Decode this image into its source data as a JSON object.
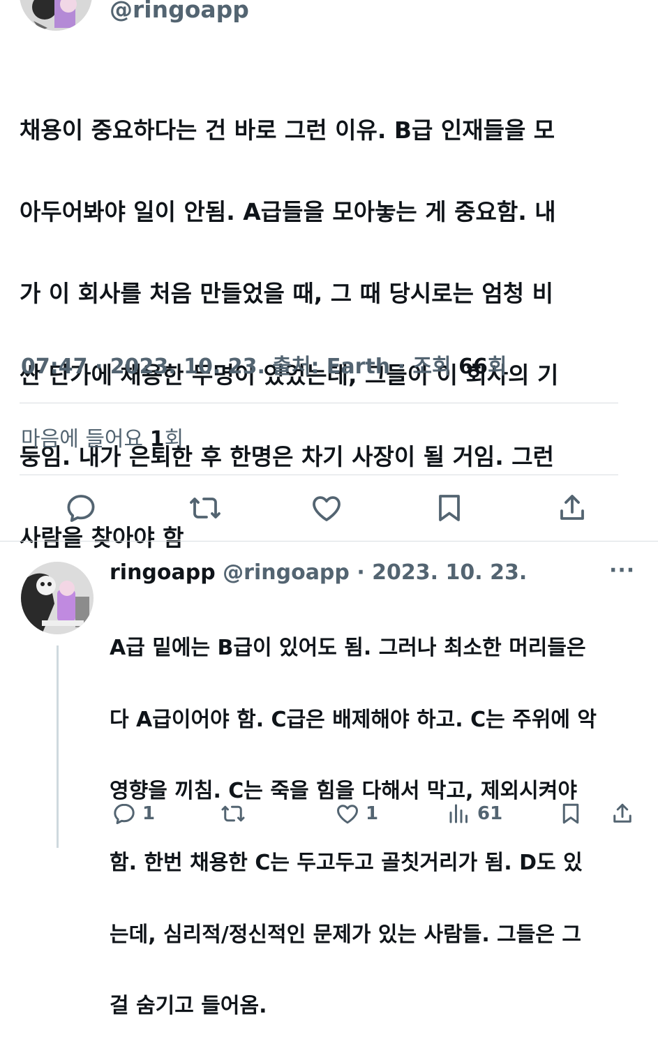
{
  "tweet": {
    "handle": "@ringoapp",
    "text_lines": [
      "채용이 중요하다는 건 바로 그런 이유. B급 인재들을 모",
      "아두어봐야 일이 안됨. A급들을 모아놓는 게 중요함. 내",
      "가 이 회사를 처음 만들었을 때, 그 때 당시로는 엄청 비",
      "싼 단가에 채용한 두명이 있었는데, 그들이 이 회사의 기",
      "둥임. 내가 은퇴한 후 한명은 차기 사장이 될 거임. 그런",
      "사람을 찾아야 함"
    ],
    "meta": {
      "time_date_source": "07:47 · 2023. 10. 23. 출처: Earth · 조회 ",
      "views": "66",
      "views_suffix": "회"
    },
    "likes": {
      "prefix": "마음에 들어요 ",
      "count": "1",
      "suffix": "회"
    },
    "actions": {
      "icons": [
        "reply-icon",
        "retweet-icon",
        "like-icon",
        "bookmark-icon",
        "share-icon"
      ],
      "color": "#536471"
    }
  },
  "reply": {
    "name": "ringoapp",
    "handle": "@ringoapp",
    "date": " · 2023. 10. 23.",
    "more": "···",
    "text_lines": [
      "A급 밑에는 B급이 있어도 됨. 그러나 최소한 머리들은",
      "다 A급이어야 함. C급은 배제해야 하고. C는 주위에 악",
      "영향을 끼침. C는 죽을 힘을 다해서 막고, 제외시켜야",
      "함. 한번 채용한 C는 두고두고 골칫거리가 됨. D도 있",
      "는데, 심리적/정신적인 문제가 있는 사람들. 그들은 그",
      "걸 숨기고 들어옴."
    ],
    "counts": {
      "replies": "1",
      "likes": "1",
      "views": "61"
    }
  },
  "colors": {
    "text": "#0f1419",
    "secondary": "#536471",
    "divider": "#d9dde1"
  }
}
